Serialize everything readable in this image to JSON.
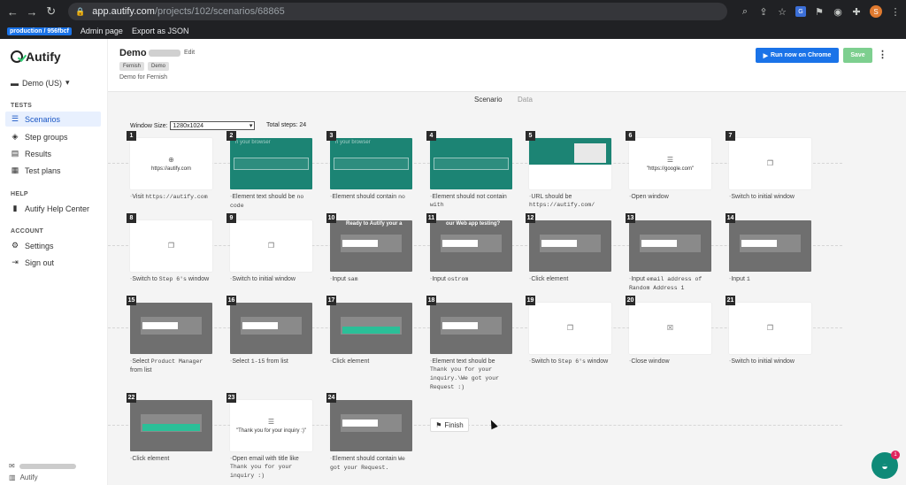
{
  "browser": {
    "url_host": "app.autify.com",
    "url_path": "/projects/102/scenarios/68865",
    "profile_initial": "S"
  },
  "bookmarks": {
    "env": "production / 956fbcf",
    "admin": "Admin page",
    "export": "Export as JSON"
  },
  "sidebar": {
    "logo": "Autify",
    "workspace": "Demo (US)",
    "tests_label": "TESTS",
    "help_label": "HELP",
    "account_label": "ACCOUNT",
    "items": [
      {
        "label": "Scenarios",
        "icon": "list-icon"
      },
      {
        "label": "Step groups",
        "icon": "layers-icon"
      },
      {
        "label": "Results",
        "icon": "results-icon"
      },
      {
        "label": "Test plans",
        "icon": "calendar-icon"
      },
      {
        "label": "Autify Help Center",
        "icon": "book-icon"
      },
      {
        "label": "Settings",
        "icon": "gear-icon"
      },
      {
        "label": "Sign out",
        "icon": "signout-icon"
      }
    ],
    "footer_org": "Autify"
  },
  "scenario": {
    "title": "Demo",
    "edit": "Edit",
    "tags": [
      "Fernish",
      "Demo"
    ],
    "description": "Demo for Fernish",
    "run_button": "Run now on Chrome",
    "save_button": "Save"
  },
  "tabs": {
    "scenario": "Scenario",
    "data": "Data"
  },
  "canvas": {
    "window_size_label": "Window Size:",
    "window_size_value": "1280x1024",
    "total_steps": "Total steps: 24",
    "finish": "Finish"
  },
  "steps": [
    {
      "n": "1",
      "thumb": "white",
      "thumb_text": "https://autify.com",
      "glyph": "⊕",
      "label_prefix": "-",
      "label": "Visit ",
      "mono": "https://autify.com"
    },
    {
      "n": "2",
      "thumb": "teal",
      "thumb_text": "h your browser",
      "label_prefix": "-",
      "label": "Element text should be ",
      "mono": "no code"
    },
    {
      "n": "3",
      "thumb": "teal",
      "thumb_text": "h your browser",
      "label_prefix": "-",
      "label": "Element should contain ",
      "mono": "no"
    },
    {
      "n": "4",
      "thumb": "teal",
      "thumb_text": "",
      "label_prefix": "-",
      "label": "Element should not contain ",
      "mono": "with"
    },
    {
      "n": "5",
      "thumb": "site",
      "thumb_text": "",
      "label_prefix": "-",
      "label": "URL should be ",
      "mono": "https://autify.com/"
    },
    {
      "n": "6",
      "thumb": "white",
      "thumb_text": "\"https://google.com\"",
      "glyph": "☰",
      "label_prefix": "-",
      "label": "Open window",
      "mono": ""
    },
    {
      "n": "7",
      "thumb": "white",
      "thumb_text": "",
      "glyph": "❐",
      "label_prefix": "-",
      "label": "Switch to initial window",
      "mono": ""
    },
    {
      "n": "8",
      "thumb": "white",
      "thumb_text": "",
      "glyph": "❐",
      "label_prefix": "-",
      "label": "Switch to ",
      "mono": "Step 6's",
      "label_after": " window"
    },
    {
      "n": "9",
      "thumb": "white",
      "thumb_text": "",
      "glyph": "❐",
      "label_prefix": "-",
      "label": "Switch to initial window",
      "mono": ""
    },
    {
      "n": "10",
      "thumb": "gray",
      "thumb_text": "Ready to Autify your a",
      "label_prefix": "-",
      "label": "Input ",
      "mono": "sam"
    },
    {
      "n": "11",
      "thumb": "gray",
      "thumb_text": "our Web app testing?",
      "label_prefix": "-",
      "label": "Input ",
      "mono": "ostrom"
    },
    {
      "n": "12",
      "thumb": "gray",
      "thumb_text": "",
      "label_prefix": "-",
      "label": "Click element",
      "mono": ""
    },
    {
      "n": "13",
      "thumb": "gray",
      "thumb_text": "",
      "label_prefix": "-",
      "label": "Input ",
      "mono": "email address of Random Address 1"
    },
    {
      "n": "14",
      "thumb": "gray",
      "thumb_text": "",
      "label_prefix": "-",
      "label": "Input ",
      "mono": "1"
    },
    {
      "n": "15",
      "thumb": "gray",
      "thumb_text": "",
      "label_prefix": "-",
      "label": "Select ",
      "mono": "Product Manager",
      "label_after": " from list"
    },
    {
      "n": "16",
      "thumb": "gray",
      "thumb_text": "",
      "label_prefix": "-",
      "label": "Select ",
      "mono": "1-15",
      "label_after": " from list"
    },
    {
      "n": "17",
      "thumb": "gray",
      "thumb_text": "",
      "label_prefix": "-",
      "label": "Click element",
      "mono": ""
    },
    {
      "n": "18",
      "thumb": "gray",
      "thumb_text": "",
      "label_prefix": "-",
      "label": "Element text should be ",
      "mono": "Thank you for your inquiry.\\We got your Request :)"
    },
    {
      "n": "19",
      "thumb": "white",
      "thumb_text": "",
      "glyph": "❐",
      "label_prefix": "-",
      "label": "Switch to ",
      "mono": "Step 6's",
      "label_after": " window"
    },
    {
      "n": "20",
      "thumb": "white",
      "thumb_text": "",
      "glyph": "☒",
      "label_prefix": "-",
      "label": "Close window",
      "mono": ""
    },
    {
      "n": "21",
      "thumb": "white",
      "thumb_text": "",
      "glyph": "❐",
      "label_prefix": "-",
      "label": "Switch to initial window",
      "mono": ""
    },
    {
      "n": "22",
      "thumb": "gray",
      "thumb_text": "",
      "label_prefix": "-",
      "label": "Click element",
      "mono": ""
    },
    {
      "n": "23",
      "thumb": "white",
      "thumb_text": "\"Thank you for your inquiry :)\"",
      "glyph": "☰",
      "label_prefix": "-",
      "label": "Open email with title like ",
      "mono": "Thank you for your inquiry :)"
    },
    {
      "n": "24",
      "thumb": "gray",
      "thumb_text": "",
      "label_prefix": "-",
      "label": "Element should contain ",
      "mono": "We got your Request."
    }
  ],
  "chat_badge": "1"
}
